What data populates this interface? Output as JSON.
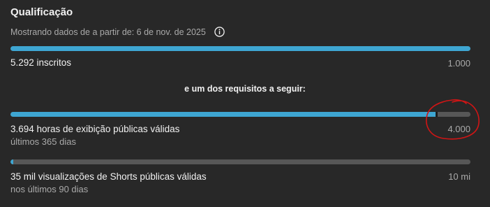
{
  "section": {
    "title": "Qualificação",
    "subtitle": "Mostrando dados de a partir de: 6 de nov. de 2025",
    "info_icon": "info-icon"
  },
  "requirements": {
    "subscribers": {
      "label": "5.292 inscritos",
      "target": "1.000",
      "progress_fraction": 1.0
    },
    "separator": "e um dos requisitos a seguir:",
    "watch_hours": {
      "label": "3.694 horas de exibição públicas válidas",
      "sublabel": "últimos 365 dias",
      "target": "4.000",
      "progress_fraction": 0.9235
    },
    "shorts_views": {
      "label": "35 mil visualizações de Shorts públicas válidas",
      "sublabel": "nos últimos 90 dias",
      "target": "10 mi",
      "progress_fraction": 0.0035
    }
  },
  "colors": {
    "accent": "#3ea6d2",
    "track": "#575757",
    "background": "#282828",
    "annotation": "#d01515"
  }
}
